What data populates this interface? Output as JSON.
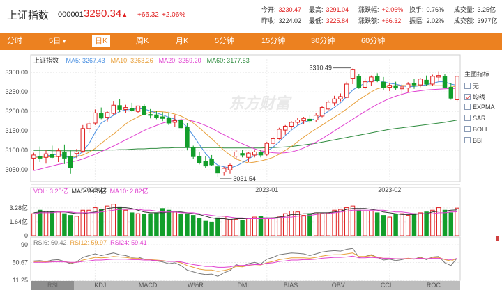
{
  "header": {
    "title": "上证指数",
    "code": "000001",
    "price": "3290.34",
    "arrow": "▲",
    "change": "+66.32",
    "change_pct": "+2.06%",
    "quotes": [
      {
        "label": "今开:",
        "value": "3230.47",
        "tone": "red"
      },
      {
        "label": "最高:",
        "value": "3291.04",
        "tone": "red"
      },
      {
        "label": "涨跌幅:",
        "value": "+2.06%",
        "tone": "red"
      },
      {
        "label": "换手:",
        "value": "0.76%",
        "tone": "plain"
      },
      {
        "label": "成交量:",
        "value": "3.25亿",
        "tone": "plain"
      },
      {
        "label": "昨收:",
        "value": "3224.02",
        "tone": "plain"
      },
      {
        "label": "最低:",
        "value": "3225.84",
        "tone": "red"
      },
      {
        "label": "涨跌额:",
        "value": "+66.32",
        "tone": "red"
      },
      {
        "label": "振幅:",
        "value": "2.02%",
        "tone": "plain"
      },
      {
        "label": "成交额:",
        "value": "3977亿",
        "tone": "plain"
      }
    ]
  },
  "tabs": [
    {
      "label": "分时",
      "caret": ""
    },
    {
      "label": "5日",
      "caret": "▼"
    },
    {
      "label": "日K",
      "caret": ""
    },
    {
      "label": "周K",
      "caret": ""
    },
    {
      "label": "月K",
      "caret": ""
    },
    {
      "label": "5分钟",
      "caret": ""
    },
    {
      "label": "15分钟",
      "caret": ""
    },
    {
      "label": "30分钟",
      "caret": ""
    },
    {
      "label": "60分钟",
      "caret": ""
    }
  ],
  "active_tab": "日K",
  "kline_legend": {
    "name": "上证指数",
    "items": [
      {
        "label": "MA5: 3267.43",
        "color": "#4a90e2"
      },
      {
        "label": "MA10: 3263.26",
        "color": "#e8a03c"
      },
      {
        "label": "MA20: 3259.20",
        "color": "#e040d0"
      },
      {
        "label": "MA60: 3177.53",
        "color": "#2e8b3e"
      }
    ]
  },
  "side_panel": {
    "title": "主图指标",
    "options": [
      {
        "label": "无",
        "checked": false
      },
      {
        "label": "均线",
        "checked": true
      },
      {
        "label": "EXPMA",
        "checked": false
      },
      {
        "label": "SAR",
        "checked": false
      },
      {
        "label": "BOLL",
        "checked": false
      },
      {
        "label": "BBI",
        "checked": false
      }
    ]
  },
  "watermark": "东方财富",
  "vol_legend": [
    {
      "label": "VOL: 3.25亿",
      "color": "#e040d0"
    },
    {
      "label": "MA5: 3.05亿",
      "color": "#333333"
    },
    {
      "label": "MA10: 2.82亿",
      "color": "#e040d0"
    }
  ],
  "rsi_legend": [
    {
      "label": "RSI6: 60.42",
      "color": "#777777"
    },
    {
      "label": "RSI12: 59.97",
      "color": "#e8a03c"
    },
    {
      "label": "RSI24: 59.41",
      "color": "#e040d0"
    }
  ],
  "bottom_tabs": [
    "RSI",
    "KDJ",
    "MACD",
    "W%R",
    "DMI",
    "BIAS",
    "OBV",
    "CCI",
    "ROC"
  ],
  "colors": {
    "up": "#e02020",
    "down": "#129e2b",
    "accent": "#ec8120"
  },
  "chart_data": {
    "type": "candlestick",
    "y_ticks": [
      "3300.00",
      "3250.00",
      "3200.00",
      "3150.00",
      "3100.00",
      "3050.00"
    ],
    "ylim": [
      3020,
      3320
    ],
    "x_labels": [
      "2022-12",
      "2023-01",
      "2023-02"
    ],
    "annotations": {
      "high": "3310.49",
      "low": "3031.54"
    },
    "candles": [
      {
        "o": 3080,
        "h": 3094,
        "l": 3050,
        "c": 3088
      },
      {
        "o": 3085,
        "h": 3110,
        "l": 3070,
        "c": 3080
      },
      {
        "o": 3082,
        "h": 3102,
        "l": 3066,
        "c": 3091
      },
      {
        "o": 3090,
        "h": 3112,
        "l": 3080,
        "c": 3082
      },
      {
        "o": 3084,
        "h": 3105,
        "l": 3070,
        "c": 3099
      },
      {
        "o": 3095,
        "h": 3115,
        "l": 3065,
        "c": 3080
      },
      {
        "o": 3085,
        "h": 3100,
        "l": 3040,
        "c": 3055
      },
      {
        "o": 3092,
        "h": 3104,
        "l": 3080,
        "c": 3096
      },
      {
        "o": 3098,
        "h": 3165,
        "l": 3094,
        "c": 3156
      },
      {
        "o": 3156,
        "h": 3175,
        "l": 3145,
        "c": 3168
      },
      {
        "o": 3170,
        "h": 3205,
        "l": 3165,
        "c": 3196
      },
      {
        "o": 3195,
        "h": 3210,
        "l": 3180,
        "c": 3183
      },
      {
        "o": 3185,
        "h": 3200,
        "l": 3174,
        "c": 3197
      },
      {
        "o": 3195,
        "h": 3227,
        "l": 3190,
        "c": 3216
      },
      {
        "o": 3215,
        "h": 3232,
        "l": 3198,
        "c": 3205
      },
      {
        "o": 3205,
        "h": 3217,
        "l": 3195,
        "c": 3210
      },
      {
        "o": 3208,
        "h": 3222,
        "l": 3200,
        "c": 3202
      },
      {
        "o": 3200,
        "h": 3213,
        "l": 3195,
        "c": 3214
      },
      {
        "o": 3212,
        "h": 3220,
        "l": 3190,
        "c": 3192
      },
      {
        "o": 3192,
        "h": 3206,
        "l": 3182,
        "c": 3190
      },
      {
        "o": 3191,
        "h": 3202,
        "l": 3180,
        "c": 3185
      },
      {
        "o": 3186,
        "h": 3198,
        "l": 3175,
        "c": 3182
      },
      {
        "o": 3183,
        "h": 3195,
        "l": 3165,
        "c": 3170
      },
      {
        "o": 3172,
        "h": 3190,
        "l": 3160,
        "c": 3176
      },
      {
        "o": 3178,
        "h": 3185,
        "l": 3155,
        "c": 3158
      },
      {
        "o": 3160,
        "h": 3170,
        "l": 3100,
        "c": 3110
      },
      {
        "o": 3108,
        "h": 3112,
        "l": 3078,
        "c": 3084
      },
      {
        "o": 3085,
        "h": 3095,
        "l": 3064,
        "c": 3068
      },
      {
        "o": 3072,
        "h": 3085,
        "l": 3055,
        "c": 3060
      },
      {
        "o": 3078,
        "h": 3088,
        "l": 3060,
        "c": 3063
      },
      {
        "o": 3058,
        "h": 3060,
        "l": 3031,
        "c": 3042
      },
      {
        "o": 3044,
        "h": 3058,
        "l": 3035,
        "c": 3054
      },
      {
        "o": 3050,
        "h": 3066,
        "l": 3040,
        "c": 3062
      },
      {
        "o": 3085,
        "h": 3102,
        "l": 3076,
        "c": 3096
      },
      {
        "o": 3092,
        "h": 3102,
        "l": 3082,
        "c": 3088
      },
      {
        "o": 3082,
        "h": 3095,
        "l": 3070,
        "c": 3093
      },
      {
        "o": 3088,
        "h": 3100,
        "l": 3082,
        "c": 3096
      },
      {
        "o": 3095,
        "h": 3102,
        "l": 3082,
        "c": 3088
      },
      {
        "o": 3090,
        "h": 3122,
        "l": 3085,
        "c": 3118
      },
      {
        "o": 3118,
        "h": 3135,
        "l": 3108,
        "c": 3130
      },
      {
        "o": 3130,
        "h": 3158,
        "l": 3128,
        "c": 3154
      },
      {
        "o": 3152,
        "h": 3165,
        "l": 3140,
        "c": 3162
      },
      {
        "o": 3162,
        "h": 3175,
        "l": 3155,
        "c": 3172
      },
      {
        "o": 3172,
        "h": 3184,
        "l": 3165,
        "c": 3178
      },
      {
        "o": 3176,
        "h": 3186,
        "l": 3168,
        "c": 3182
      },
      {
        "o": 3180,
        "h": 3190,
        "l": 3170,
        "c": 3176
      },
      {
        "o": 3178,
        "h": 3195,
        "l": 3172,
        "c": 3190
      },
      {
        "o": 3188,
        "h": 3214,
        "l": 3185,
        "c": 3210
      },
      {
        "o": 3206,
        "h": 3228,
        "l": 3200,
        "c": 3224
      },
      {
        "o": 3222,
        "h": 3240,
        "l": 3215,
        "c": 3232
      },
      {
        "o": 3232,
        "h": 3246,
        "l": 3226,
        "c": 3238
      },
      {
        "o": 3236,
        "h": 3276,
        "l": 3234,
        "c": 3270
      },
      {
        "o": 3285,
        "h": 3310,
        "l": 3270,
        "c": 3308
      },
      {
        "o": 3290,
        "h": 3296,
        "l": 3258,
        "c": 3262
      },
      {
        "o": 3262,
        "h": 3285,
        "l": 3255,
        "c": 3276
      },
      {
        "o": 3276,
        "h": 3292,
        "l": 3265,
        "c": 3288
      },
      {
        "o": 3290,
        "h": 3298,
        "l": 3275,
        "c": 3278
      },
      {
        "o": 3275,
        "h": 3288,
        "l": 3255,
        "c": 3262
      },
      {
        "o": 3262,
        "h": 3272,
        "l": 3252,
        "c": 3267
      },
      {
        "o": 3266,
        "h": 3276,
        "l": 3254,
        "c": 3260
      },
      {
        "o": 3258,
        "h": 3270,
        "l": 3240,
        "c": 3263
      },
      {
        "o": 3260,
        "h": 3275,
        "l": 3250,
        "c": 3270
      },
      {
        "o": 3272,
        "h": 3284,
        "l": 3258,
        "c": 3268
      },
      {
        "o": 3268,
        "h": 3286,
        "l": 3262,
        "c": 3283
      },
      {
        "o": 3280,
        "h": 3292,
        "l": 3266,
        "c": 3270
      },
      {
        "o": 3270,
        "h": 3294,
        "l": 3266,
        "c": 3290
      },
      {
        "o": 3288,
        "h": 3303,
        "l": 3276,
        "c": 3292
      },
      {
        "o": 3290,
        "h": 3296,
        "l": 3260,
        "c": 3262
      },
      {
        "o": 3262,
        "h": 3272,
        "l": 3230,
        "c": 3234
      },
      {
        "o": 3230,
        "h": 3291,
        "l": 3226,
        "c": 3290
      }
    ],
    "ma5": [
      3085,
      3084,
      3086,
      3088,
      3090,
      3086,
      3079,
      3083,
      3098,
      3117,
      3146,
      3170,
      3180,
      3190,
      3200,
      3204,
      3205,
      3207,
      3206,
      3201,
      3196,
      3191,
      3185,
      3180,
      3174,
      3160,
      3138,
      3115,
      3092,
      3075,
      3062,
      3058,
      3055,
      3060,
      3068,
      3078,
      3087,
      3092,
      3098,
      3108,
      3122,
      3138,
      3152,
      3164,
      3172,
      3177,
      3182,
      3190,
      3200,
      3210,
      3222,
      3238,
      3255,
      3265,
      3272,
      3280,
      3280,
      3276,
      3272,
      3270,
      3266,
      3263,
      3264,
      3266,
      3268,
      3272,
      3276,
      3276,
      3270,
      3267
    ],
    "ma10": [
      3082,
      3082,
      3083,
      3084,
      3085,
      3085,
      3084,
      3084,
      3088,
      3095,
      3105,
      3118,
      3130,
      3142,
      3155,
      3168,
      3178,
      3186,
      3193,
      3198,
      3200,
      3199,
      3197,
      3193,
      3188,
      3180,
      3170,
      3158,
      3144,
      3130,
      3115,
      3100,
      3088,
      3078,
      3072,
      3068,
      3070,
      3073,
      3077,
      3082,
      3090,
      3100,
      3110,
      3122,
      3134,
      3145,
      3155,
      3165,
      3175,
      3185,
      3195,
      3206,
      3218,
      3230,
      3240,
      3250,
      3258,
      3262,
      3264,
      3266,
      3267,
      3266,
      3266,
      3266,
      3266,
      3266,
      3266,
      3266,
      3265,
      3263
    ],
    "ma20": [
      3048,
      3052,
      3056,
      3060,
      3064,
      3067,
      3070,
      3073,
      3078,
      3084,
      3090,
      3097,
      3104,
      3111,
      3119,
      3127,
      3135,
      3143,
      3151,
      3158,
      3164,
      3170,
      3174,
      3177,
      3179,
      3178,
      3175,
      3170,
      3164,
      3157,
      3148,
      3140,
      3132,
      3124,
      3117,
      3110,
      3104,
      3099,
      3096,
      3094,
      3093,
      3094,
      3096,
      3100,
      3106,
      3113,
      3121,
      3130,
      3140,
      3150,
      3160,
      3170,
      3180,
      3190,
      3200,
      3209,
      3218,
      3226,
      3233,
      3239,
      3244,
      3248,
      3251,
      3253,
      3255,
      3256,
      3257,
      3258,
      3259,
      3259
    ],
    "ma60": [
      3100,
      3100,
      3100,
      3099,
      3099,
      3099,
      3099,
      3099,
      3099,
      3099,
      3100,
      3100,
      3101,
      3101,
      3102,
      3102,
      3103,
      3104,
      3104,
      3105,
      3105,
      3106,
      3106,
      3107,
      3107,
      3107,
      3107,
      3107,
      3107,
      3107,
      3107,
      3106,
      3106,
      3106,
      3106,
      3106,
      3106,
      3106,
      3107,
      3107,
      3108,
      3109,
      3110,
      3112,
      3114,
      3116,
      3118,
      3121,
      3124,
      3127,
      3130,
      3133,
      3136,
      3139,
      3142,
      3145,
      3148,
      3151,
      3154,
      3156,
      3158,
      3160,
      3162,
      3164,
      3166,
      3168,
      3170,
      3172,
      3175,
      3177.53
    ],
    "volume_ticks": [
      "3.28亿",
      "1.64亿",
      "0"
    ],
    "volume_max": 4.9,
    "volume": [
      2.6,
      3.0,
      2.9,
      2.9,
      2.8,
      2.6,
      2.4,
      2.3,
      3.0,
      3.0,
      3.3,
      3.1,
      3.5,
      3.7,
      3.4,
      3.0,
      2.7,
      2.6,
      2.5,
      2.6,
      2.7,
      3.2,
      3.0,
      2.8,
      2.5,
      2.6,
      2.4,
      2.0,
      1.7,
      1.6,
      2.1,
      2.3,
      1.9,
      1.9,
      1.8,
      2.0,
      2.2,
      2.3,
      2.0,
      2.1,
      2.3,
      2.6,
      2.9,
      2.8,
      2.4,
      2.6,
      2.7,
      2.6,
      2.7,
      3.0,
      3.1,
      3.3,
      3.5,
      3.0,
      2.9,
      2.9,
      2.7,
      2.4,
      2.2,
      2.5,
      2.6,
      2.4,
      2.6,
      2.7,
      2.8,
      3.0,
      3.3,
      3.0,
      2.7,
      3.25
    ],
    "vol_ma5": [
      2.7,
      2.8,
      2.8,
      2.8,
      2.8,
      2.8,
      2.7,
      2.6,
      2.6,
      2.7,
      2.8,
      3.0,
      3.2,
      3.3,
      3.3,
      3.3,
      3.2,
      3.0,
      2.8,
      2.7,
      2.7,
      2.7,
      2.8,
      2.8,
      2.8,
      2.7,
      2.6,
      2.5,
      2.3,
      2.1,
      2.0,
      2.0,
      1.9,
      2.0,
      2.0,
      2.0,
      2.0,
      2.1,
      2.1,
      2.1,
      2.2,
      2.3,
      2.5,
      2.5,
      2.6,
      2.6,
      2.7,
      2.7,
      2.7,
      2.8,
      2.9,
      3.1,
      3.2,
      3.2,
      3.2,
      3.1,
      3.0,
      2.8,
      2.7,
      2.6,
      2.5,
      2.5,
      2.5,
      2.6,
      2.6,
      2.8,
      2.9,
      2.9,
      3.0,
      3.05
    ],
    "vol_ma10": [
      2.6,
      2.7,
      2.7,
      2.7,
      2.8,
      2.8,
      2.8,
      2.7,
      2.7,
      2.7,
      2.7,
      2.8,
      2.9,
      3.0,
      3.1,
      3.1,
      3.1,
      3.1,
      3.0,
      3.0,
      2.9,
      2.8,
      2.8,
      2.8,
      2.7,
      2.7,
      2.7,
      2.6,
      2.5,
      2.4,
      2.3,
      2.3,
      2.2,
      2.1,
      2.1,
      2.0,
      2.0,
      2.0,
      2.0,
      2.0,
      2.1,
      2.2,
      2.2,
      2.3,
      2.3,
      2.4,
      2.5,
      2.6,
      2.6,
      2.7,
      2.8,
      2.9,
      3.0,
      3.0,
      3.0,
      3.0,
      3.0,
      3.0,
      2.9,
      2.8,
      2.8,
      2.7,
      2.6,
      2.6,
      2.6,
      2.6,
      2.7,
      2.7,
      2.8,
      2.82
    ],
    "rsi_ticks": [
      "90",
      "50.67",
      "11.25"
    ],
    "rsi_ylim": [
      11.25,
      90
    ],
    "rsi6": [
      54,
      55,
      53,
      56,
      57,
      53,
      48,
      52,
      62,
      66,
      70,
      66,
      69,
      72,
      68,
      66,
      62,
      63,
      58,
      56,
      54,
      52,
      48,
      50,
      44,
      34,
      30,
      26,
      24,
      25,
      20,
      28,
      33,
      46,
      42,
      48,
      51,
      47,
      58,
      62,
      68,
      70,
      72,
      71,
      70,
      66,
      70,
      74,
      76,
      77,
      76,
      80,
      82,
      62,
      64,
      68,
      62,
      56,
      58,
      55,
      57,
      60,
      58,
      63,
      57,
      63,
      64,
      50,
      44,
      60.42
    ],
    "rsi12": [
      52,
      53,
      52,
      53,
      54,
      53,
      50,
      51,
      56,
      59,
      62,
      61,
      62,
      64,
      63,
      62,
      60,
      60,
      58,
      57,
      56,
      55,
      53,
      53,
      50,
      44,
      40,
      36,
      34,
      34,
      31,
      33,
      36,
      42,
      41,
      44,
      46,
      45,
      50,
      53,
      57,
      59,
      61,
      61,
      61,
      60,
      62,
      65,
      67,
      68,
      68,
      70,
      72,
      64,
      64,
      66,
      63,
      60,
      60,
      59,
      59,
      60,
      59,
      61,
      59,
      61,
      62,
      57,
      54,
      59.97
    ],
    "rsi24": [
      51,
      51,
      51,
      52,
      52,
      52,
      51,
      51,
      53,
      54,
      56,
      56,
      57,
      58,
      58,
      58,
      57,
      57,
      56,
      56,
      55,
      54,
      53,
      53,
      52,
      49,
      46,
      44,
      42,
      42,
      40,
      40,
      41,
      44,
      44,
      45,
      46,
      46,
      49,
      50,
      53,
      54,
      56,
      56,
      57,
      57,
      58,
      60,
      61,
      62,
      62,
      63,
      65,
      61,
      61,
      62,
      61,
      60,
      60,
      59,
      59,
      59,
      59,
      60,
      59,
      60,
      60,
      58,
      57,
      59.41
    ]
  }
}
